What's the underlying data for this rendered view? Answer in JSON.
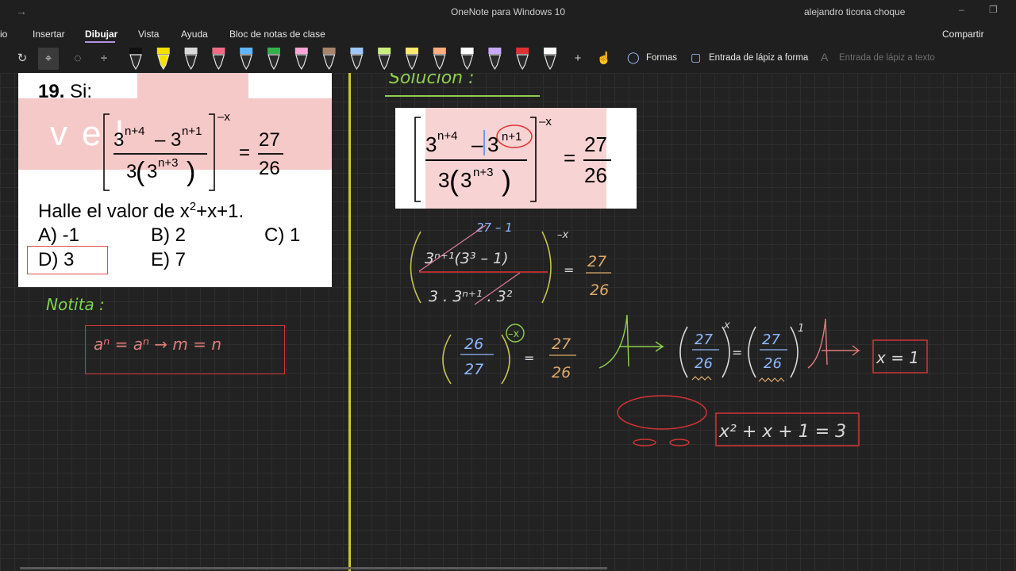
{
  "titlebar": {
    "title": "OneNote para Windows 10",
    "user": "alejandro ticona choque",
    "back_icon": "arrow-right-icon",
    "minimize": "–",
    "restore": "❐"
  },
  "menu": {
    "items": [
      {
        "label": "io"
      },
      {
        "label": "Insertar"
      },
      {
        "label": "Dibujar"
      },
      {
        "label": "Vista"
      },
      {
        "label": "Ayuda"
      },
      {
        "label": "Bloc de notas de clase"
      }
    ],
    "share_label": "Compartir"
  },
  "toolbar": {
    "shapes_label": "Formas",
    "ink_to_shape_label": "Entrada de lápiz a forma",
    "ink_to_text_label": "Entrada de lápiz a texto",
    "pen_colors": [
      "#111111",
      "#f5e100",
      "#d9d9d9",
      "#f26b84",
      "#5fb6ff",
      "#31b24a",
      "#ffa6d8",
      "#a7856a",
      "#9ec8ff",
      "#c8f07a",
      "#ffe870",
      "#ffae82",
      "#ffffff",
      "#c9a8ff",
      "#e03232",
      "#ffffff"
    ]
  },
  "problem": {
    "number": "19.",
    "si": "Si:",
    "watermark": "vel",
    "num_a_base": "3",
    "num_a_exp": "n+4",
    "minus": "–",
    "num_b_base": "3",
    "num_b_exp": "n+1",
    "den_coef": "3",
    "den_base": "3",
    "den_exp": "n+3",
    "outer_exp": "–x",
    "equals": "=",
    "rhs_num": "27",
    "rhs_den": "26",
    "question_pre": "Halle el valor de x",
    "question_sup": "2",
    "question_post": "+x+1.",
    "options": [
      {
        "label": "A) -1"
      },
      {
        "label": "B) 2"
      },
      {
        "label": "C) 1"
      },
      {
        "label": "D) 3"
      },
      {
        "label": "E) 7"
      }
    ]
  },
  "notes": {
    "notita": "Notita :",
    "rule": "aⁿ = aⁿ  →  m = n",
    "solucion": "Solución :",
    "step1_top": "27 – 1",
    "step1_num": "3ⁿ⁺¹(3³ – 1)",
    "step1_den": "3 . 3ⁿ⁺¹ . 3²",
    "step1_exp": "–x",
    "step1_rhs_num": "27",
    "step1_rhs_den": "26",
    "step2_lhs_num": "26",
    "step2_lhs_den": "27",
    "step2_exp": "–x",
    "step2_rhs_num": "27",
    "step2_rhs_den": "26",
    "step3_a_num": "27",
    "step3_a_den": "26",
    "step3_a_exp": "x",
    "step3_b_num": "27",
    "step3_b_den": "26",
    "step3_b_exp": "1",
    "result_x": "x = 1",
    "final": "x² + x + 1 = 3"
  }
}
